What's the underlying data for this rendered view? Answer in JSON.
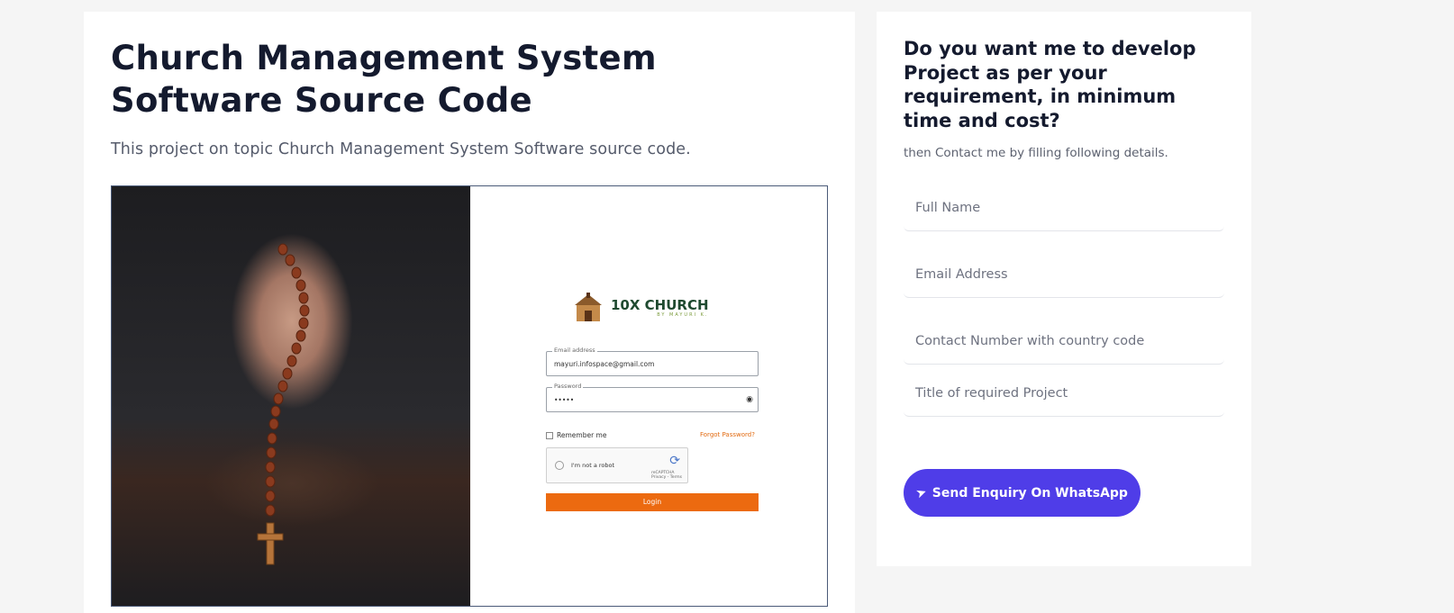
{
  "article": {
    "title": "Church Management System Software Source Code",
    "description": "This project on topic Church Management System Software source code.",
    "screenshot": {
      "logo_text": "10X CHURCH",
      "logo_sub": "BY MAYURI K.",
      "email_label": "Email address",
      "email_value": "mayuri.infospace@gmail.com",
      "password_label": "Password",
      "password_value": "•••••",
      "remember_label": "Remember me",
      "forgot_label": "Forgot Password?",
      "captcha_label": "I'm not a robot",
      "captcha_brand": "reCAPTCHA",
      "captcha_links": "Privacy - Terms",
      "login_label": "Login"
    }
  },
  "enquiry": {
    "title": "Do you want me to develop Project as per your requirement, in minimum time and cost?",
    "subtitle": "then Contact me by filling following details.",
    "fields": {
      "full_name": "Full Name",
      "email": "Email Address",
      "contact": "Contact Number with country code",
      "project_title": "Title of required Project"
    },
    "button_label": "Send Enquiry On WhatsApp",
    "button_color": "#4f3de8"
  }
}
